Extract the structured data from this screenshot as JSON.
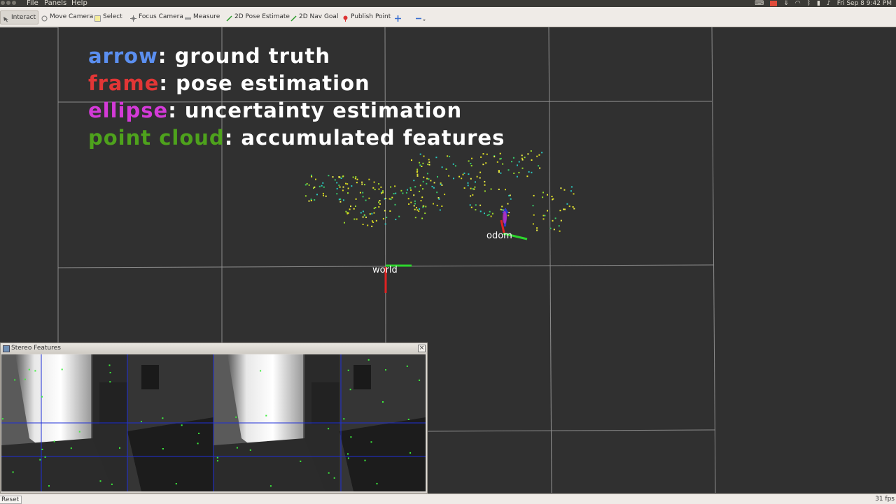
{
  "menubar": {
    "menus": [
      "File",
      "Panels",
      "Help"
    ],
    "clock": "Fri Sep 8  9:42 PM"
  },
  "toolbar": {
    "tools": [
      {
        "label": "Interact",
        "icon": "interact-icon",
        "active": true
      },
      {
        "label": "Move Camera",
        "icon": "move-camera-icon"
      },
      {
        "label": "Select",
        "icon": "select-icon"
      },
      {
        "label": "Focus Camera",
        "icon": "focus-camera-icon"
      },
      {
        "label": "Measure",
        "icon": "measure-icon"
      },
      {
        "label": "2D Pose Estimate",
        "icon": "pose-estimate-icon"
      },
      {
        "label": "2D Nav Goal",
        "icon": "nav-goal-icon"
      },
      {
        "label": "Publish Point",
        "icon": "publish-point-icon"
      }
    ]
  },
  "legend": {
    "arrow_key": "arrow",
    "arrow_desc": ": ground truth",
    "frame_key": "frame",
    "frame_desc": ": pose estimation",
    "ellipse_key": "ellipse",
    "ellipse_desc": ": uncertainty estimation",
    "cloud_key": "point cloud",
    "cloud_desc": ": accumulated features"
  },
  "frames": {
    "odom": "odom",
    "world": "world"
  },
  "panel": {
    "title": "Stereo Features",
    "close": "×"
  },
  "statusbar": {
    "reset": "Reset",
    "fps": "31 fps"
  },
  "colors": {
    "arrow": "#5b8ff0",
    "frame": "#e23636",
    "ellipse": "#d43ad8",
    "cloud": "#4ea21c",
    "background": "#303030",
    "grid": "#8a8a8a"
  }
}
